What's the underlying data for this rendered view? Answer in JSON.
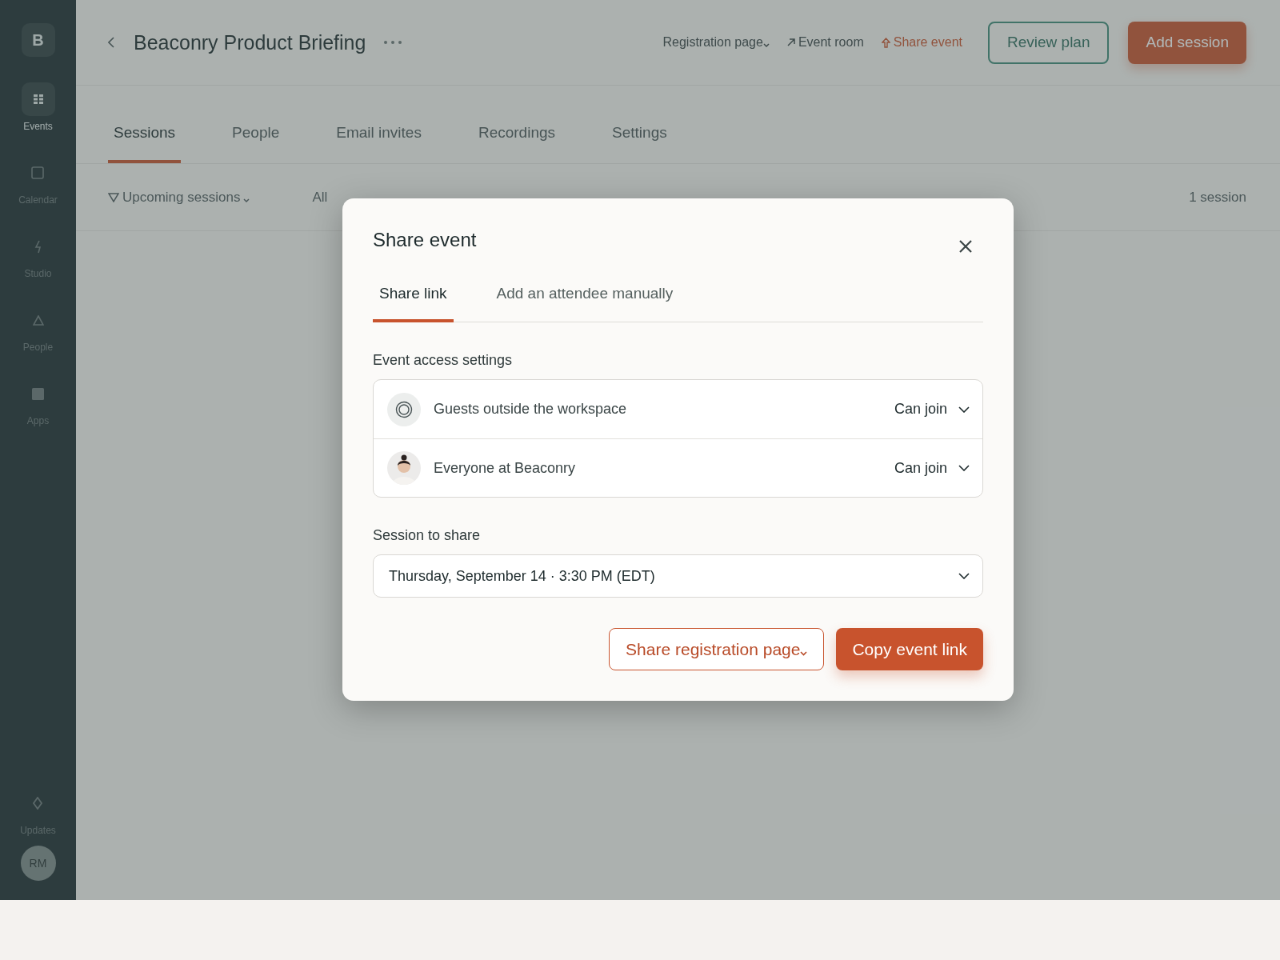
{
  "sidebar": {
    "logo": "B",
    "items": [
      {
        "label": "Events",
        "selected": true
      },
      {
        "label": "Calendar",
        "selected": false
      },
      {
        "label": "Studio",
        "selected": false
      },
      {
        "label": "People",
        "selected": false
      },
      {
        "label": "Apps",
        "selected": false
      }
    ],
    "footer_item": {
      "label": "Updates"
    },
    "user_initials": "RM"
  },
  "header": {
    "title": "Beaconry Product Briefing",
    "links": [
      {
        "label": "Registration page",
        "kind": "dropdown"
      },
      {
        "label": "Event room",
        "kind": "external"
      },
      {
        "label": "Share event",
        "kind": "share"
      }
    ],
    "buttons": [
      {
        "label": "Review plan",
        "kind": "outline"
      },
      {
        "label": "Add session",
        "kind": "primary"
      }
    ]
  },
  "tabs": [
    {
      "label": "Sessions",
      "selected": true
    },
    {
      "label": "People",
      "selected": false
    },
    {
      "label": "Email invites",
      "selected": false
    },
    {
      "label": "Recordings",
      "selected": false
    },
    {
      "label": "Settings",
      "selected": false
    }
  ],
  "filters": [
    {
      "label": "Upcoming sessions",
      "kind": "filter"
    },
    {
      "label": "All",
      "kind": "plain"
    }
  ],
  "session_count": "1 session",
  "modal": {
    "title": "Share event",
    "tabs": [
      {
        "label": "Share link",
        "selected": true
      },
      {
        "label": "Add an attendee manually",
        "selected": false
      }
    ],
    "access_label": "Event access settings",
    "access_rows": [
      {
        "name": "Guests outside the workspace",
        "permission": "Can join",
        "kind": "group"
      },
      {
        "name": "Everyone at Beaconry",
        "permission": "Can join",
        "kind": "person"
      }
    ],
    "session_label": "Session to share",
    "session_value": "Thursday, September 14 · 3:30 PM (EDT)",
    "buttons": [
      {
        "label": "Share registration page",
        "kind": "outline_dropdown"
      },
      {
        "label": "Copy event link",
        "kind": "primary"
      }
    ]
  }
}
